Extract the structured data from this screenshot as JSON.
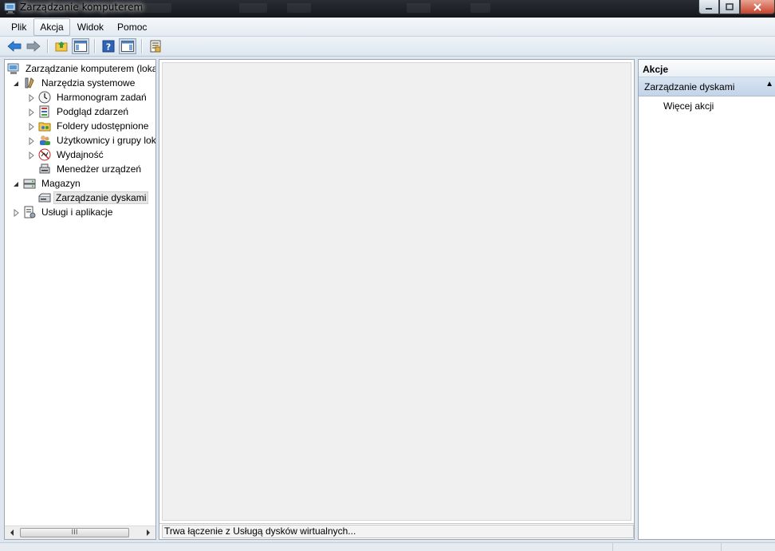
{
  "window": {
    "title": "Zarządzanie komputerem"
  },
  "menu": [
    {
      "label": "Plik",
      "active": false
    },
    {
      "label": "Akcja",
      "active": true
    },
    {
      "label": "Widok",
      "active": false
    },
    {
      "label": "Pomoc",
      "active": false
    }
  ],
  "toolbar": {
    "buttons": [
      "back-arrow-icon",
      "forward-arrow-icon",
      "up-folder-icon",
      "show-hide-tree-icon",
      "help-icon",
      "show-hide-action-pane-icon",
      "properties-icon"
    ]
  },
  "tree": {
    "root": "Zarządzanie komputerem (lokalne)",
    "items": [
      {
        "label": "Zarządzanie komputerem (loka",
        "level": 0,
        "icon": "computer-management-icon",
        "expander": "none"
      },
      {
        "label": "Narzędzia systemowe",
        "level": 1,
        "icon": "system-tools-icon",
        "expander": "expanded"
      },
      {
        "label": "Harmonogram zadań",
        "level": 2,
        "icon": "task-scheduler-icon",
        "expander": "collapsed"
      },
      {
        "label": "Podgląd zdarzeń",
        "level": 2,
        "icon": "event-viewer-icon",
        "expander": "collapsed"
      },
      {
        "label": "Foldery udostępnione",
        "level": 2,
        "icon": "shared-folders-icon",
        "expander": "collapsed"
      },
      {
        "label": "Użytkownicy i grupy lok",
        "level": 2,
        "icon": "users-groups-icon",
        "expander": "collapsed"
      },
      {
        "label": "Wydajność",
        "level": 2,
        "icon": "performance-icon",
        "expander": "collapsed"
      },
      {
        "label": "Menedżer urządzeń",
        "level": 2,
        "icon": "device-manager-icon",
        "expander": "none"
      },
      {
        "label": "Magazyn",
        "level": 1,
        "icon": "storage-icon",
        "expander": "expanded"
      },
      {
        "label": "Zarządzanie dyskami",
        "level": 2,
        "icon": "disk-management-icon",
        "expander": "none",
        "selected": true
      },
      {
        "label": "Usługi i aplikacje",
        "level": 1,
        "icon": "services-apps-icon",
        "expander": "collapsed"
      }
    ],
    "scroll_thumb_glyph": "III"
  },
  "center": {
    "status_message": "Trwa łączenie z Usługą dysków wirtualnych..."
  },
  "actions": {
    "header": "Akcje",
    "section": "Zarządzanie dyskami",
    "items": [
      "Więcej akcji"
    ]
  },
  "colors": {
    "selection_section": "#c3d4e8",
    "titlebar": "#14161a"
  }
}
